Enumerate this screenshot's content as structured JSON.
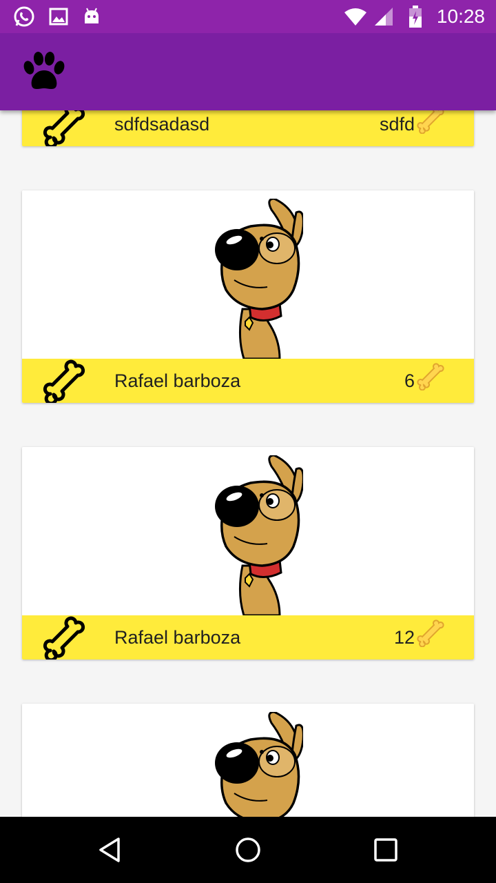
{
  "status_bar": {
    "time": "10:28",
    "icons": [
      "whatsapp-icon",
      "gallery-icon",
      "android-icon",
      "wifi-icon",
      "signal-icon",
      "battery-icon"
    ]
  },
  "app_bar": {
    "logo": "paw-icon",
    "color": "#7b1fa2"
  },
  "posts": [
    {
      "name": "sdfdsadasd",
      "likes": "sdfd"
    },
    {
      "name": "Rafael barboza",
      "likes": "6"
    },
    {
      "name": "Rafael barboza",
      "likes": "12"
    },
    {
      "name": "",
      "likes": ""
    }
  ],
  "colors": {
    "status_bar": "#8e24aa",
    "footer": "#ffeb3b",
    "background": "#f5f5f5"
  },
  "nav": {
    "buttons": [
      "back-icon",
      "home-icon",
      "recents-icon"
    ]
  }
}
